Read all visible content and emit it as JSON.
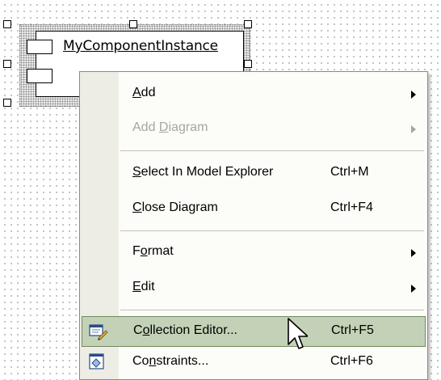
{
  "component": {
    "name": "MyComponentInstance"
  },
  "menu": {
    "items": [
      {
        "pre": "",
        "key": "A",
        "post": "dd",
        "shortcut": "",
        "submenu": true,
        "disabled": false
      },
      {
        "pre": "Add ",
        "key": "D",
        "post": "iagram",
        "shortcut": "",
        "submenu": true,
        "disabled": true
      },
      {
        "pre": "",
        "key": "S",
        "post": "elect In Model Explorer",
        "shortcut": "Ctrl+M",
        "submenu": false,
        "disabled": false
      },
      {
        "pre": "",
        "key": "C",
        "post": "lose Diagram",
        "shortcut": "Ctrl+F4",
        "submenu": false,
        "disabled": false
      },
      {
        "pre": "F",
        "key": "o",
        "post": "rmat",
        "shortcut": "",
        "submenu": true,
        "disabled": false
      },
      {
        "pre": "",
        "key": "E",
        "post": "dit",
        "shortcut": "",
        "submenu": true,
        "disabled": false
      },
      {
        "pre": "C",
        "key": "o",
        "post": "llection Editor...",
        "shortcut": "Ctrl+F5",
        "submenu": false,
        "disabled": false,
        "selected": true,
        "icon": "collection-editor-icon"
      },
      {
        "pre": "Co",
        "key": "n",
        "post": "straints...",
        "shortcut": "Ctrl+F6",
        "submenu": false,
        "disabled": false,
        "icon": "constraints-icon"
      }
    ]
  },
  "colors": {
    "highlight": "#c3d2b6",
    "highlight_border": "#6f8a5e",
    "disabled_text": "#a7a69e",
    "gutter": "#eeede5"
  }
}
